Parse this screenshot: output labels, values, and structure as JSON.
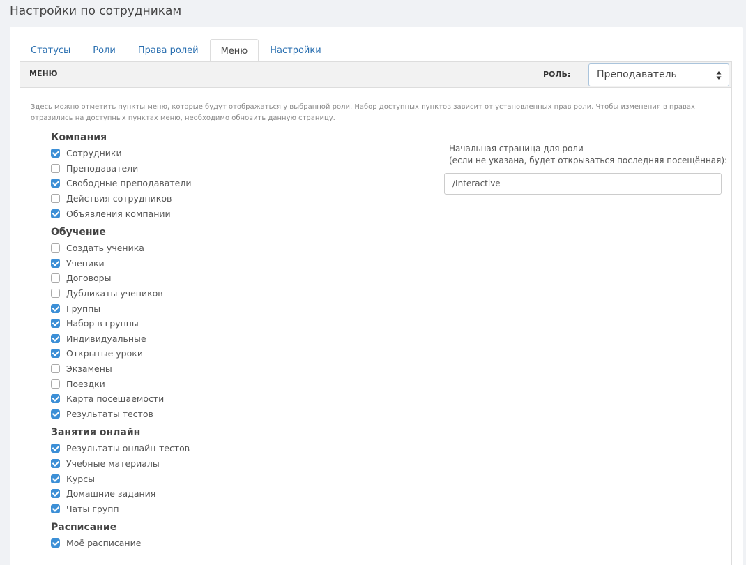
{
  "page": {
    "title": "Настройки по сотрудникам"
  },
  "tabs": [
    {
      "label": "Статусы",
      "active": false
    },
    {
      "label": "Роли",
      "active": false
    },
    {
      "label": "Права ролей",
      "active": false
    },
    {
      "label": "Меню",
      "active": true
    },
    {
      "label": "Настройки",
      "active": false
    }
  ],
  "panel": {
    "menu_label": "МЕНЮ",
    "role_label": "РОЛЬ:",
    "role_value": "Преподаватель",
    "hint": "Здесь можно отметить пункты меню, которые будут отображаться у выбранной роли. Набор доступных пунктов зависит от установленных прав роли. Чтобы изменения в правах отразились на доступных пунктах меню, необходимо обновить данную страницу.",
    "start_page_label_1": "Начальная страница для роли",
    "start_page_label_2": "(если не указана, будет открываться последняя посещённая):",
    "start_page_value": "/Interactive"
  },
  "groups": [
    {
      "title": "Компания",
      "items": [
        {
          "label": "Сотрудники",
          "checked": true
        },
        {
          "label": "Преподаватели",
          "checked": false
        },
        {
          "label": "Свободные преподаватели",
          "checked": true
        },
        {
          "label": "Действия сотрудников",
          "checked": false
        },
        {
          "label": "Объявления компании",
          "checked": true
        }
      ]
    },
    {
      "title": "Обучение",
      "items": [
        {
          "label": "Создать ученика",
          "checked": false
        },
        {
          "label": "Ученики",
          "checked": true
        },
        {
          "label": "Договоры",
          "checked": false
        },
        {
          "label": "Дубликаты учеников",
          "checked": false
        },
        {
          "label": "Группы",
          "checked": true
        },
        {
          "label": "Набор в группы",
          "checked": true
        },
        {
          "label": "Индивидуальные",
          "checked": true
        },
        {
          "label": "Открытые уроки",
          "checked": true
        },
        {
          "label": "Экзамены",
          "checked": false
        },
        {
          "label": "Поездки",
          "checked": false
        },
        {
          "label": "Карта посещаемости",
          "checked": true
        },
        {
          "label": "Результаты тестов",
          "checked": true
        }
      ]
    },
    {
      "title": "Занятия онлайн",
      "items": [
        {
          "label": "Результаты онлайн-тестов",
          "checked": true
        },
        {
          "label": "Учебные материалы",
          "checked": true
        },
        {
          "label": "Курсы",
          "checked": true
        },
        {
          "label": "Домашние задания",
          "checked": true
        },
        {
          "label": "Чаты групп",
          "checked": true
        }
      ]
    },
    {
      "title": "Расписание",
      "items": [
        {
          "label": "Моё расписание",
          "checked": true
        }
      ]
    }
  ],
  "colors": {
    "accent": "#3c8fd6",
    "link": "#2a6fb0"
  }
}
